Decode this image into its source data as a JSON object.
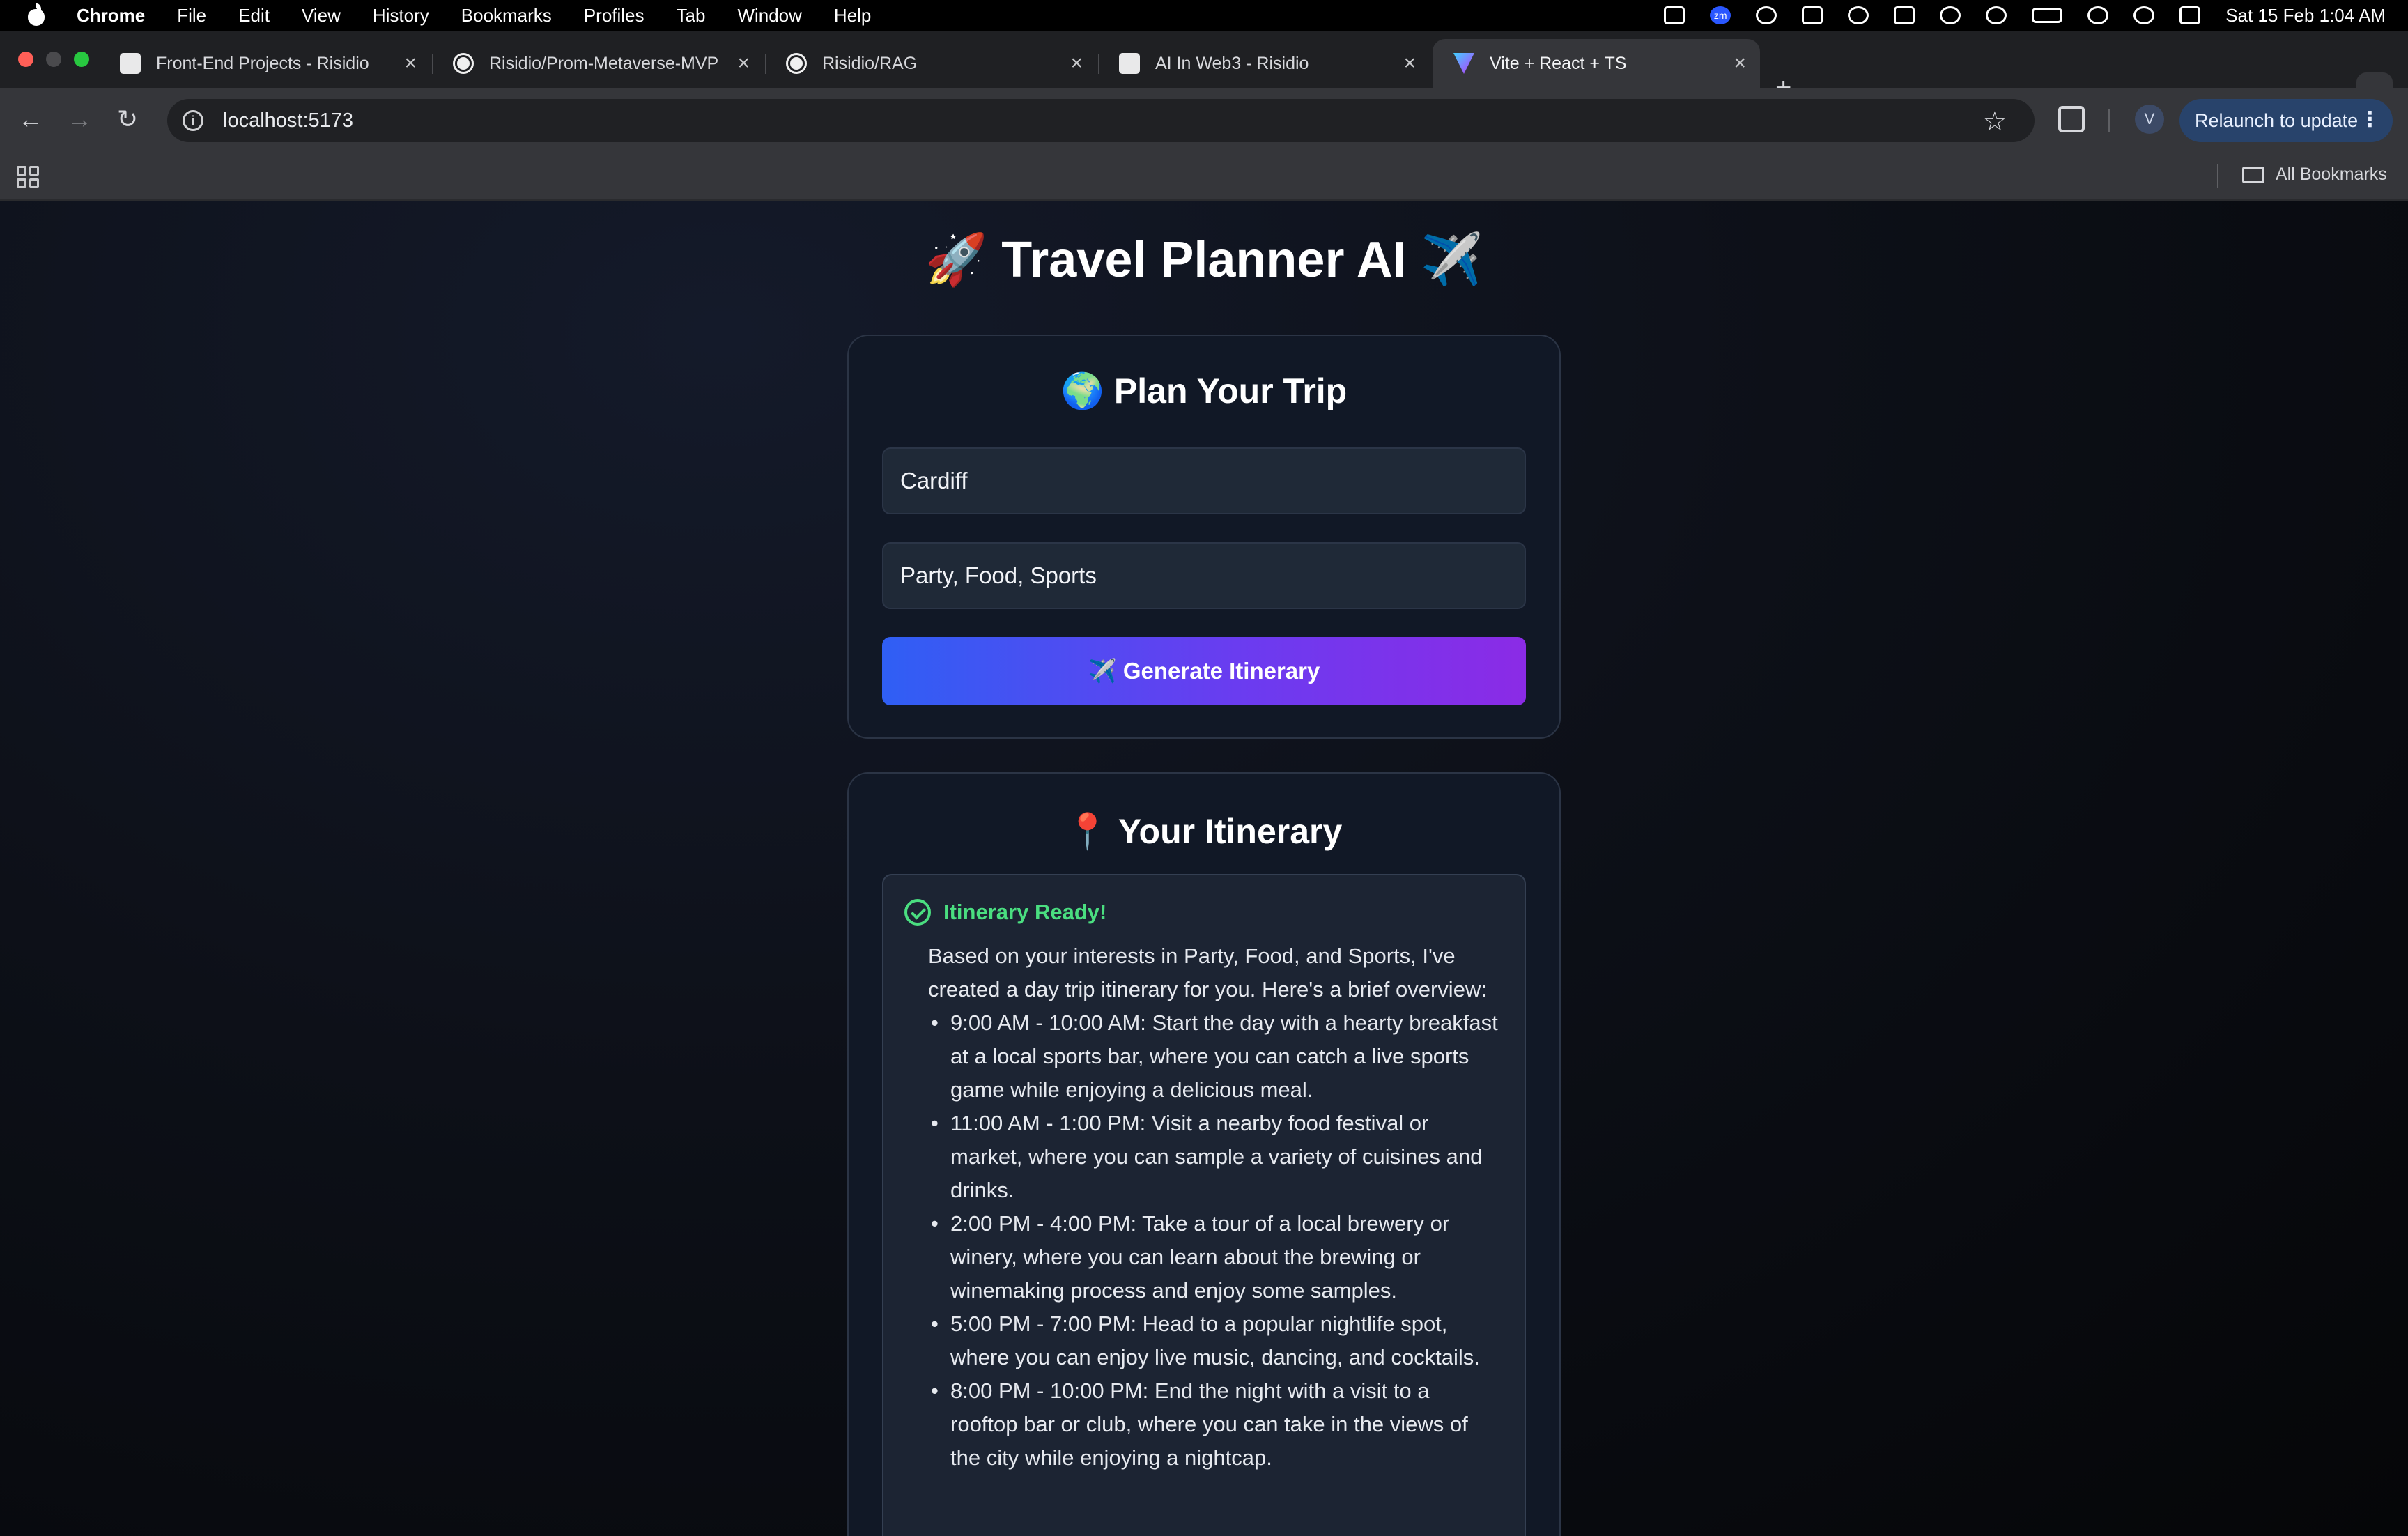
{
  "menubar": {
    "app_name": "Chrome",
    "items": [
      "File",
      "Edit",
      "View",
      "History",
      "Bookmarks",
      "Profiles",
      "Tab",
      "Window",
      "Help"
    ],
    "clock": "Sat 15 Feb  1:04 AM",
    "zoom_badge": "zm"
  },
  "tabs": [
    {
      "title": "Front-End Projects - Risidio",
      "icon": "notion-icon"
    },
    {
      "title": "Risidio/Prom-Metaverse-MVP",
      "icon": "github-icon"
    },
    {
      "title": "Risidio/RAG",
      "icon": "github-icon"
    },
    {
      "title": "AI In Web3 - Risidio",
      "icon": "notion-icon"
    },
    {
      "title": "Vite + React + TS",
      "icon": "vite-icon",
      "active": true
    }
  ],
  "toolbar": {
    "url": "localhost:5173",
    "profile_initial": "V",
    "relaunch_label": "Relaunch to update"
  },
  "bookmarks": {
    "all_bookmarks_label": "All Bookmarks"
  },
  "page": {
    "title": "🚀 Travel Planner AI ✈️",
    "plan_card": {
      "title": "🌍 Plan Your Trip",
      "city_value": "Cardiff",
      "interests_value": "Party, Food, Sports",
      "generate_label": "✈️ Generate Itinerary"
    },
    "itinerary_card": {
      "title": "📍 Your Itinerary",
      "status": "Itinerary Ready!",
      "intro": "Based on your interests in Party, Food, and Sports, I've created a day trip itinerary for you. Here's a brief overview:",
      "items": [
        "9:00 AM - 10:00 AM: Start the day with a hearty breakfast at a local sports bar, where you can catch a live sports game while enjoying a delicious meal.",
        "11:00 AM - 1:00 PM: Visit a nearby food festival or market, where you can sample a variety of cuisines and drinks.",
        "2:00 PM - 4:00 PM: Take a tour of a local brewery or winery, where you can learn about the brewing or winemaking process and enjoy some samples.",
        "5:00 PM - 7:00 PM: Head to a popular nightlife spot, where you can enjoy live music, dancing, and cocktails.",
        "8:00 PM - 10:00 PM: End the night with a visit to a rooftop bar or club, where you can take in the views of the city while enjoying a nightcap."
      ]
    }
  },
  "colors": {
    "accent_green": "#4ade80",
    "button_gradient_start": "#2f5ff4",
    "button_gradient_end": "#8b2be6",
    "card_background": "#111826"
  }
}
